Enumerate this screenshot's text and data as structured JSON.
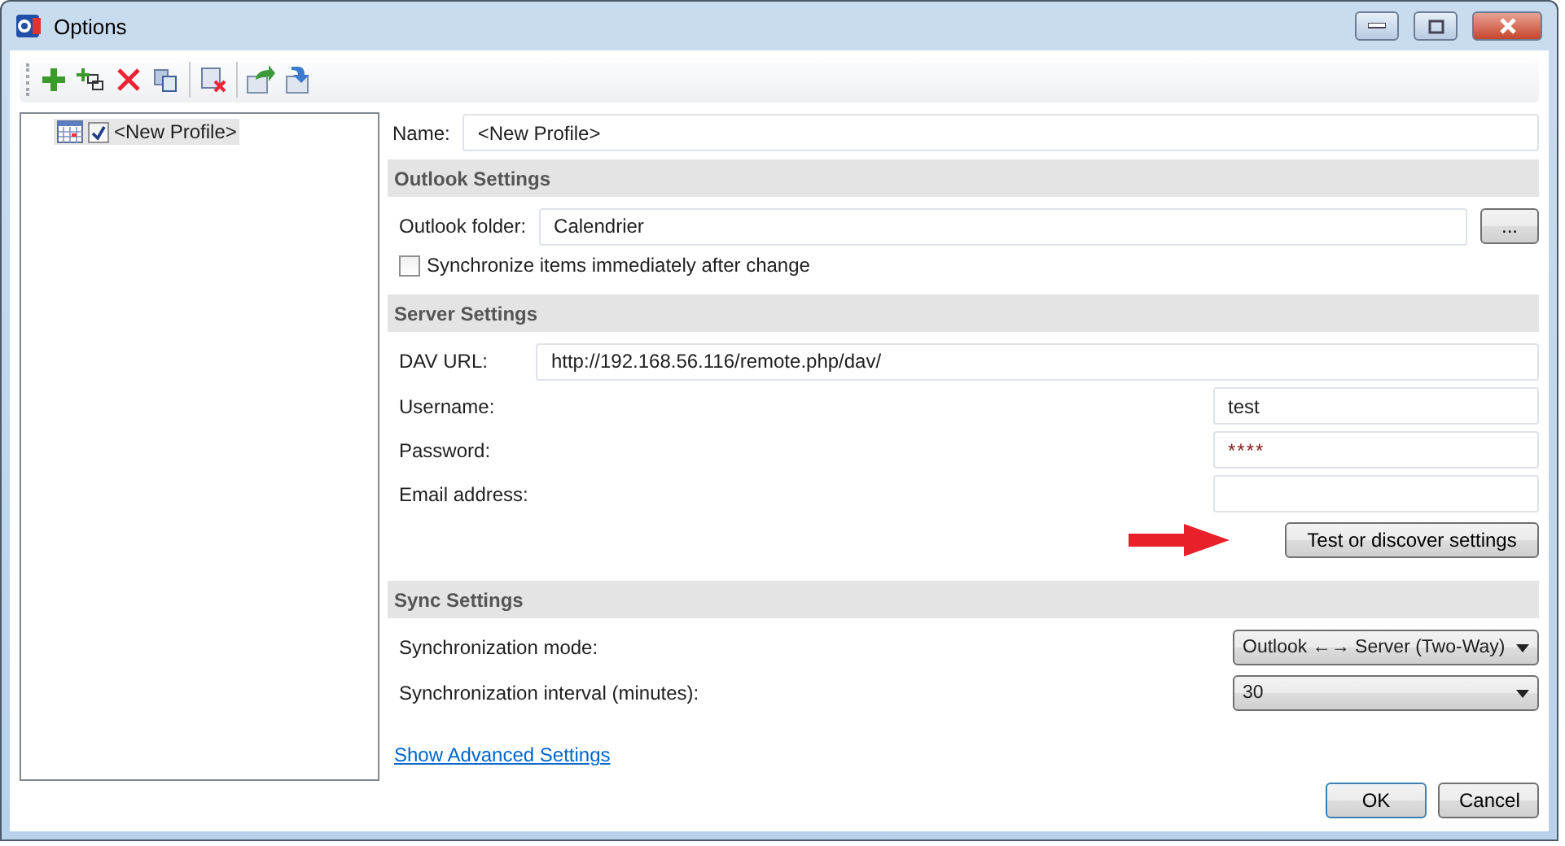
{
  "window": {
    "title": "Options"
  },
  "tree": [
    {
      "label": "<New Profile>",
      "checked": true,
      "selected": true
    }
  ],
  "name": {
    "label": "Name:",
    "value": "<New Profile>"
  },
  "outlook_settings": {
    "header": "Outlook Settings",
    "folder_label": "Outlook folder:",
    "folder_value": "Calendrier",
    "browse": "...",
    "sync_immediately": {
      "label": "Synchronize items immediately after change",
      "checked": false
    }
  },
  "server_settings": {
    "header": "Server Settings",
    "dav_url": {
      "label": "DAV URL:",
      "value": "http://192.168.56.116/remote.php/dav/"
    },
    "fields": [
      {
        "label": "Username:",
        "value": "test"
      },
      {
        "label": "Password:",
        "value": "****"
      },
      {
        "label": "Email address:"
      }
    ],
    "test_button": "Test or discover settings"
  },
  "sync_settings": {
    "header": "Sync Settings",
    "rows": [
      {
        "label": "Synchronization mode:",
        "value": "Outlook ←→ Server (Two-Way)"
      },
      {
        "label": "Synchronization interval (minutes):",
        "value": "30"
      }
    ]
  },
  "advanced_link": "Show Advanced Settings",
  "buttons": [
    {
      "label": "OK",
      "default": true
    },
    {
      "label": "Cancel",
      "default": false
    }
  ]
}
